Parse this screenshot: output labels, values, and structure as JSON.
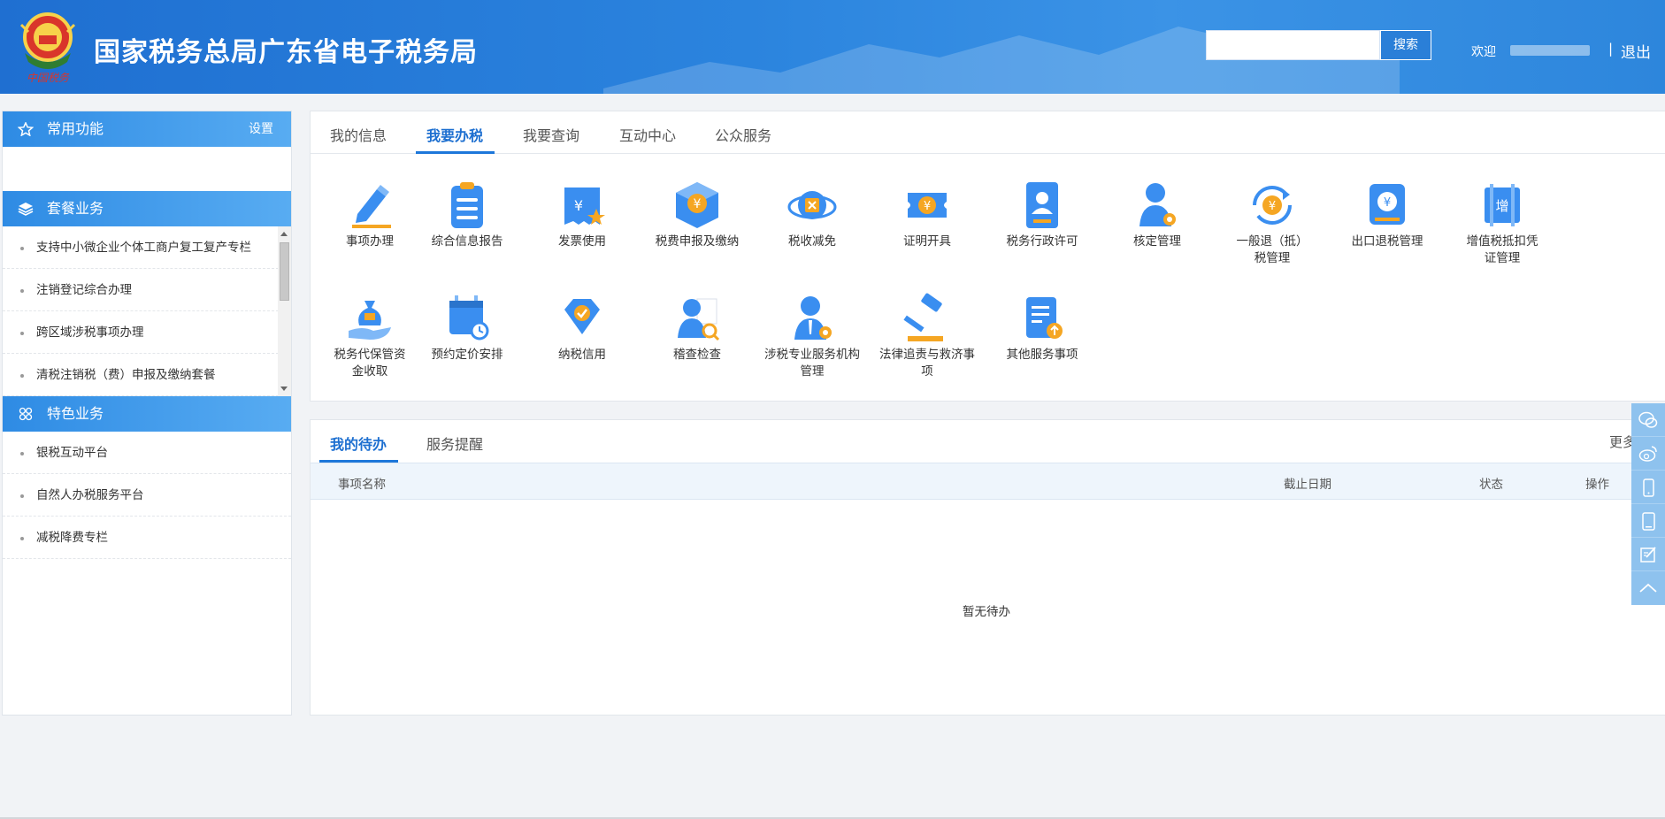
{
  "header": {
    "site_title": "国家税务总局广东省电子税务局",
    "emblem_caption": "中国税务",
    "search_placeholder": "",
    "search_button": "搜索",
    "welcome": "欢迎",
    "separator": "|",
    "logout": "退出"
  },
  "sidebar": {
    "favorites": {
      "title": "常用功能",
      "settings": "设置",
      "icon": "star-icon"
    },
    "packages": {
      "title": "套餐业务",
      "icon": "layers-icon",
      "items": [
        {
          "label": "支持中小微企业个体工商户复工复产专栏"
        },
        {
          "label": "注销登记综合办理"
        },
        {
          "label": "跨区域涉税事项办理"
        },
        {
          "label": "清税注销税（费）申报及缴纳套餐"
        }
      ]
    },
    "featured": {
      "title": "特色业务",
      "icon": "grid-icon",
      "items": [
        {
          "label": "银税互动平台"
        },
        {
          "label": "自然人办税服务平台"
        },
        {
          "label": "减税降费专栏"
        }
      ]
    }
  },
  "main": {
    "tabs": [
      {
        "label": "我的信息",
        "active": false
      },
      {
        "label": "我要办税",
        "active": true
      },
      {
        "label": "我要查询",
        "active": false
      },
      {
        "label": "互动中心",
        "active": false
      },
      {
        "label": "公众服务",
        "active": false
      }
    ],
    "functions": [
      {
        "label": "事项办理",
        "icon": "pen-icon"
      },
      {
        "label": "综合信息报告",
        "icon": "clipboard-icon"
      },
      {
        "label": "发票使用",
        "icon": "invoice-icon"
      },
      {
        "label": "税费申报及缴纳",
        "icon": "box-yuan-icon"
      },
      {
        "label": "税收减免",
        "icon": "tax-reduction-icon"
      },
      {
        "label": "证明开具",
        "icon": "ticket-yuan-icon"
      },
      {
        "label": "税务行政许可",
        "icon": "id-badge-icon"
      },
      {
        "label": "核定管理",
        "icon": "user-gear-icon"
      },
      {
        "label": "一般退（抵）税管理",
        "icon": "refund-cycle-icon"
      },
      {
        "label": "出口退税管理",
        "icon": "export-refund-icon"
      },
      {
        "label": "增值税抵扣凭证管理",
        "icon": "vat-voucher-icon"
      },
      {
        "label": "税务代保管资金收取",
        "icon": "money-bag-hand-icon"
      },
      {
        "label": "预约定价安排",
        "icon": "calendar-clock-icon"
      },
      {
        "label": "纳税信用",
        "icon": "diamond-check-icon"
      },
      {
        "label": "稽查检查",
        "icon": "inspector-search-icon"
      },
      {
        "label": "涉税专业服务机构管理",
        "icon": "agent-gear-icon"
      },
      {
        "label": "法律追责与救济事项",
        "icon": "gavel-icon"
      },
      {
        "label": "其他服务事项",
        "icon": "list-upload-icon"
      }
    ]
  },
  "todo": {
    "tabs": [
      {
        "label": "我的待办",
        "active": true
      },
      {
        "label": "服务提醒",
        "active": false
      }
    ],
    "more": "更多",
    "columns": {
      "name": "事项名称",
      "deadline": "截止日期",
      "status": "状态",
      "action": "操作"
    },
    "empty_text": "暂无待办"
  },
  "float_toolbar": [
    {
      "icon": "wechat-icon"
    },
    {
      "icon": "weibo-icon"
    },
    {
      "icon": "mobile-icon"
    },
    {
      "icon": "tablet-icon"
    },
    {
      "icon": "feedback-edit-icon"
    },
    {
      "icon": "back-to-top-icon"
    }
  ],
  "colors": {
    "brand_blue": "#1f6fd1",
    "accent": "#1d77da",
    "icon_blue": "#3a8ef0",
    "icon_orange": "#f5a623"
  }
}
